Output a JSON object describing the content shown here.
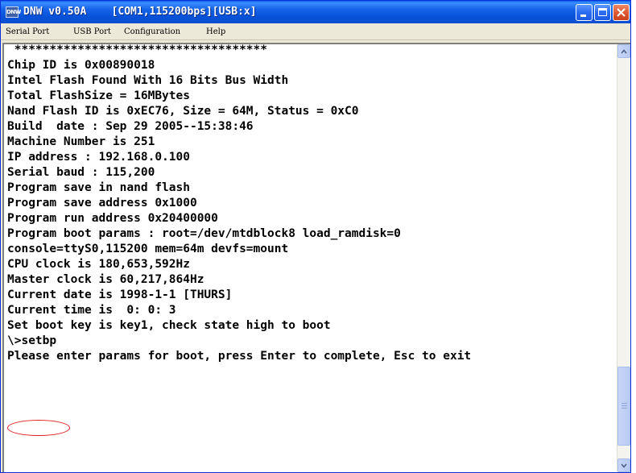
{
  "window": {
    "title": "DNW v0.50A    [COM1,115200bps][USB:x]",
    "icon_label": "DNW",
    "titlebar_color": "#0752d8",
    "close_color": "#dd5a33"
  },
  "menu": {
    "items": [
      {
        "label": "Serial Port"
      },
      {
        "label": "USB Port"
      },
      {
        "label": "Configuration"
      },
      {
        "label": "Help"
      }
    ]
  },
  "terminal": {
    "lines": [
      " ************************************",
      "Chip ID is 0x00890018",
      "Intel Flash Found With 16 Bits Bus Width",
      "Total FlashSize = 16MBytes",
      "Nand Flash ID is 0xEC76, Size = 64M, Status = 0xC0",
      "Build  date : Sep 29 2005--15:38:46",
      "Machine Number is 251",
      "IP address : 192.168.0.100",
      "Serial baud : 115,200",
      "Program save in nand flash",
      "Program save address 0x1000",
      "Program run address 0x20400000",
      "Program boot params : root=/dev/mtdblock8 load_ramdisk=0",
      "console=ttyS0,115200 mem=64m devfs=mount",
      "CPU clock is 180,653,592Hz",
      "Master clock is 60,217,864Hz",
      "Current date is 1998-1-1 [THURS]",
      "Current time is  0: 0: 3",
      "Set boot key is key1, check state high to boot",
      "\\>setbp",
      "Please enter params for boot, press Enter to complete, Esc to exit"
    ],
    "highlight_color": "#e02020"
  },
  "icons": {
    "app": "app-icon",
    "minimize": "minimize-icon",
    "maximize": "maximize-icon",
    "close": "close-icon",
    "scroll_up": "chevron-up-icon",
    "scroll_down": "chevron-down-icon"
  }
}
